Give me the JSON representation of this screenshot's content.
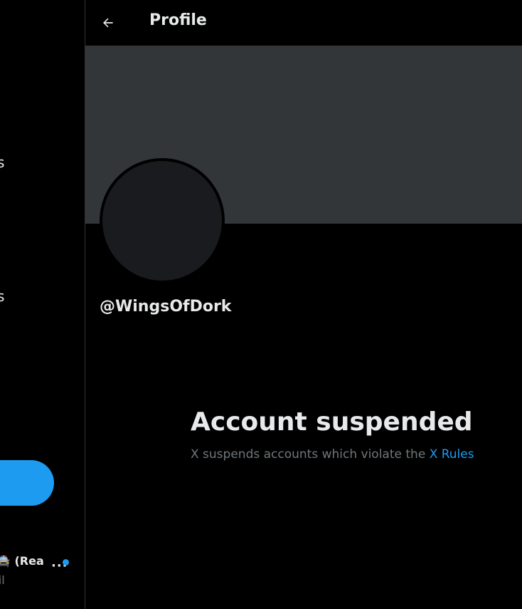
{
  "sidebar": {
    "nav_fragments": [
      "s",
      "s"
    ],
    "post_button_label": "",
    "account": {
      "name": "🚔 (Rea",
      "handle": "ail",
      "more_icon": "ellipsis-icon",
      "notification": true
    }
  },
  "header": {
    "title": "Profile",
    "back_icon": "arrow-left-icon"
  },
  "profile": {
    "handle": "@WingsOfDork"
  },
  "suspension": {
    "title": "Account suspended",
    "description": "X suspends accounts which violate the ",
    "link_text": "X Rules"
  },
  "colors": {
    "background": "#000000",
    "banner": "#333639",
    "avatar": "#1a1b1e",
    "accent": "#1d9bf0",
    "primary_text": "#e7e9ea",
    "secondary_text": "#71767b",
    "border": "#2f3336"
  }
}
